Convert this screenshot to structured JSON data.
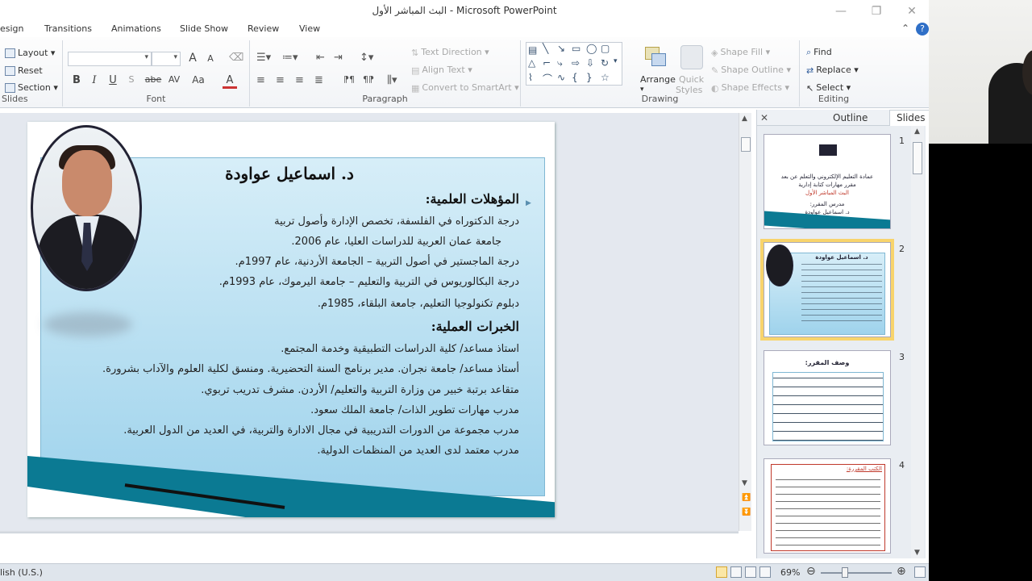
{
  "window": {
    "title": "البث المباشر الأول  -  Microsoft PowerPoint",
    "minimize": "—",
    "restore": "❐",
    "close": "✕"
  },
  "tabs": [
    {
      "label": "esign"
    },
    {
      "label": "Transitions"
    },
    {
      "label": "Animations"
    },
    {
      "label": "Slide Show"
    },
    {
      "label": "Review"
    },
    {
      "label": "View"
    }
  ],
  "ribbon": {
    "slides_group": {
      "layout": "Layout",
      "reset": "Reset",
      "section": "Section",
      "label": "Slides"
    },
    "font_group": {
      "label": "Font",
      "bold": "B",
      "italic": "I",
      "underline": "U",
      "strike": "abe",
      "spacing": "AV",
      "case": "Aa",
      "color": "A",
      "grow": "A",
      "shrink": "A"
    },
    "paragraph_group": {
      "label": "Paragraph",
      "text_direction": "Text Direction",
      "align_text": "Align Text",
      "convert": "Convert to SmartArt"
    },
    "drawing_group": {
      "label": "Drawing",
      "arrange": "Arrange",
      "quick_styles_1": "Quick",
      "quick_styles_2": "Styles",
      "shape_fill": "Shape Fill",
      "shape_outline": "Shape Outline",
      "shape_effects": "Shape Effects"
    },
    "editing_group": {
      "label": "Editing",
      "find": "Find",
      "replace": "Replace",
      "select": "Select"
    }
  },
  "slide": {
    "title": "د. اسماعيل عواودة",
    "qual_heading": "المؤهلات العلمية:",
    "qualifications": [
      "درجة الدكتوراه في الفلسفة، تخصص الإدارة وأصول تربية",
      "جامعة عمان العربية للدراسات العليا، عام 2006.",
      "درجة الماجستير في أصول التربية – الجامعة الأردنية، عام 1997م.",
      "درجة البكالوريوس في التربية والتعليم – جامعة اليرموك، عام 1993م.",
      "دبلوم تكنولوجيا التعليم، جامعة البلقاء، 1985م."
    ],
    "exp_heading": "الخبرات العملية:",
    "experiences": [
      "استاذ مساعد/ كلية الدراسات التطبيقية وخدمة المجتمع.",
      "أستاذ مساعد/ جامعة نجران. مدير برنامج السنة التحضيرية. ومنسق لكلية العلوم والآداب بشرورة.",
      "متقاعد برتبة خبير من وزارة التربية والتعليم/ الأردن. مشرف تدريب تربوي.",
      "مدرب مهارات تطوير الذات/ جامعة الملك سعود.",
      "مدرب مجموعة من الدورات التدريبية في مجال الادارة والتربية، في العديد من الدول العربية.",
      "مدرب معتمد لدى العديد من المنظمات الدولية."
    ]
  },
  "pane": {
    "close": "✕",
    "outline_tab": "Outline",
    "slides_tab": "Slides",
    "thumbs": [
      {
        "num": "1",
        "lines": [
          "عمادة التعليم الإلكتروني والتعلم عن بعد",
          "مقرر مهارات كتابة إدارية",
          "البث المباشر الأول",
          "مدرس المقرر:",
          "د. اسماعيل عواودة"
        ]
      },
      {
        "num": "2",
        "lines": [
          "د. اسماعيل عواودة"
        ]
      },
      {
        "num": "3",
        "lines": [
          "وصف المقرر:"
        ]
      },
      {
        "num": "4",
        "lines": [
          "الكتب المقررة:"
        ]
      }
    ]
  },
  "status": {
    "language": "lish (U.S.)",
    "zoom": "69%",
    "zoom_out": "⊖",
    "zoom_in": "⊕"
  }
}
